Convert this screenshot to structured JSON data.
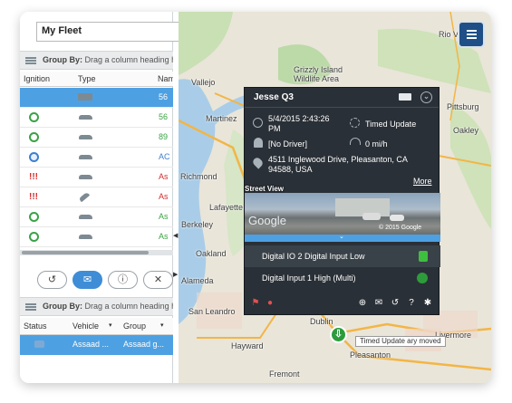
{
  "fleet_select": {
    "value": "My Fleet"
  },
  "group_bar_top": {
    "title": "Group By:",
    "hint": "Drag a column heading h"
  },
  "vehicle_table": {
    "columns": [
      "Ignition",
      "Type",
      "Nam"
    ],
    "rows": [
      {
        "ignition": "",
        "type": "truck",
        "name": "56",
        "selected": true
      },
      {
        "ignition": "on",
        "type": "car",
        "name": "56",
        "color": "#3aa346"
      },
      {
        "ignition": "on",
        "type": "car",
        "name": "89",
        "color": "#3aa346"
      },
      {
        "ignition": "off",
        "type": "car",
        "name": "AC",
        "color": "#3f7fcf"
      },
      {
        "ignition": "!!!",
        "type": "car",
        "name": "As",
        "color": "#d42e2e"
      },
      {
        "ignition": "!!!",
        "type": "tow",
        "name": "As",
        "color": "#d42e2e"
      },
      {
        "ignition": "on",
        "type": "car",
        "name": "As",
        "color": "#3aa346"
      },
      {
        "ignition": "on",
        "type": "car",
        "name": "As",
        "color": "#3aa346"
      }
    ]
  },
  "toolbar": {
    "buttons": [
      "history-icon",
      "message-icon",
      "alert-icon",
      "tools-icon"
    ]
  },
  "group_bar_bottom": {
    "title": "Group By:",
    "hint": "Drag a column heading h"
  },
  "status_table": {
    "columns": [
      "Status",
      "Vehicle",
      "Group"
    ],
    "row": {
      "vehicle": "Assaad ...",
      "group": "Assaad g..."
    }
  },
  "popup": {
    "title": "Jesse Q3",
    "date": "5/4/2015 2:43:26 PM",
    "event": "Timed Update",
    "driver": "[No Driver]",
    "speed": "0 mi/h",
    "address": "4511 Inglewood Drive, Pleasanton, CA 94588, USA",
    "more": "More",
    "street_view_label": "Street View",
    "street_view_copyright": "© 2015 Google",
    "google_logo": "Google",
    "io": [
      {
        "label": "Digital IO 2 Digital Input Low",
        "highlight": true
      },
      {
        "label": "Digital Input 1 High (Multi)",
        "highlight": false
      }
    ]
  },
  "map": {
    "labels": [
      {
        "text": "Grizzly Island",
        "id": "grizzly"
      },
      {
        "text": "Wildlife Area",
        "id": "wildlife"
      },
      {
        "text": "Rio Vista",
        "id": "riovista"
      },
      {
        "text": "Vallejo",
        "id": "vallejo"
      },
      {
        "text": "Martinez",
        "id": "martinez"
      },
      {
        "text": "Pittsburg",
        "id": "pittsburg"
      },
      {
        "text": "Oakley",
        "id": "oakley"
      },
      {
        "text": "Richmond",
        "id": "richmond"
      },
      {
        "text": "Lafayette",
        "id": "lafayette"
      },
      {
        "text": "Berkeley",
        "id": "berkeley"
      },
      {
        "text": "Oakland",
        "id": "oakland"
      },
      {
        "text": "Alameda",
        "id": "alameda"
      },
      {
        "text": "San Leandro",
        "id": "sanleandro"
      },
      {
        "text": "Dublin",
        "id": "dublin"
      },
      {
        "text": "Hayward",
        "id": "hayward"
      },
      {
        "text": "Pleasanton",
        "id": "pleasanton"
      },
      {
        "text": "Livermore",
        "id": "livermore"
      },
      {
        "text": "Fremont",
        "id": "fremont"
      }
    ],
    "callout": "Timed Update ary moved"
  }
}
